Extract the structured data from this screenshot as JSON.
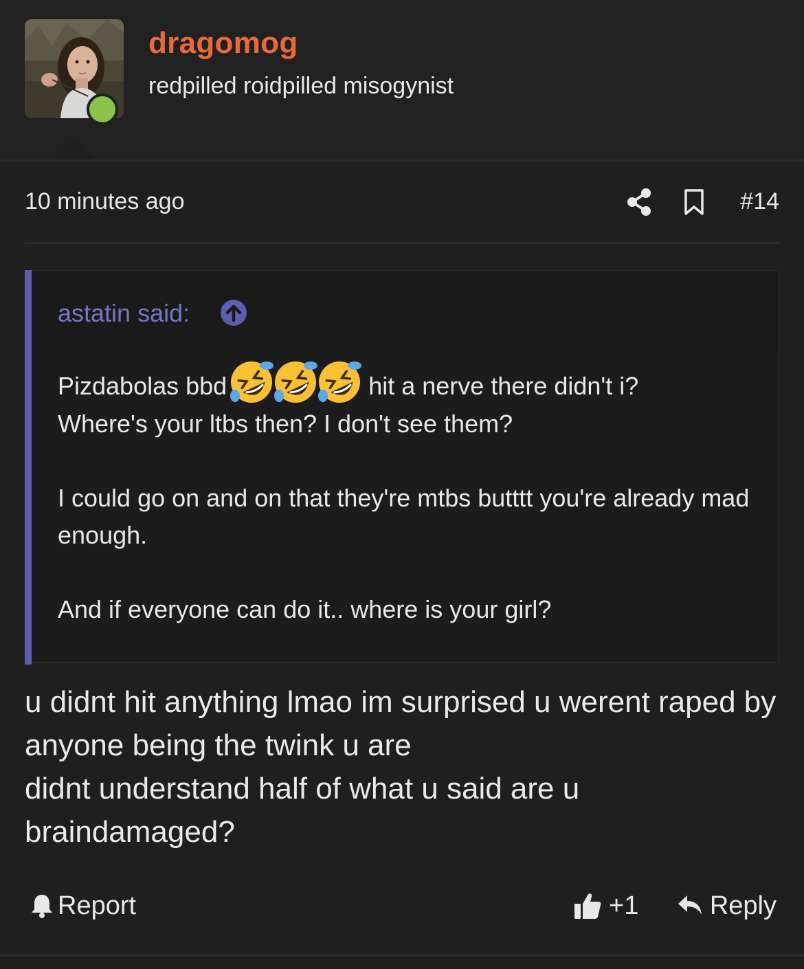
{
  "user": {
    "name": "dragomog",
    "title": "redpilled roidpilled misogynist",
    "online": true,
    "name_color": "#e86a3a",
    "online_color": "#8bc34a"
  },
  "meta": {
    "time": "10 minutes ago",
    "post_number": "#14",
    "icons": [
      "share-icon",
      "bookmark-icon"
    ]
  },
  "quote": {
    "author_label": "astatin said:",
    "accent_color": "#5b5fae",
    "line1_before": "Pizdabolas bbd",
    "emoji": [
      "rolling-on-floor-laughing-emoji",
      "rolling-on-floor-laughing-emoji",
      "rolling-on-floor-laughing-emoji"
    ],
    "line1_after": "hit a nerve there didn't i?",
    "line2": "Where's your ltbs then? I don't see them?",
    "para2": "I could go on and on that they're mtbs butttt you're already mad enough.",
    "para3": "And if everyone can do it.. where is your girl?"
  },
  "reply": {
    "line1": "u didnt hit anything lmao im surprised u werent raped by anyone being the twink u are",
    "line2": "didnt understand half of what u said are u braindamaged?"
  },
  "actions": {
    "report": "Report",
    "like": "+1",
    "reply": "Reply"
  }
}
